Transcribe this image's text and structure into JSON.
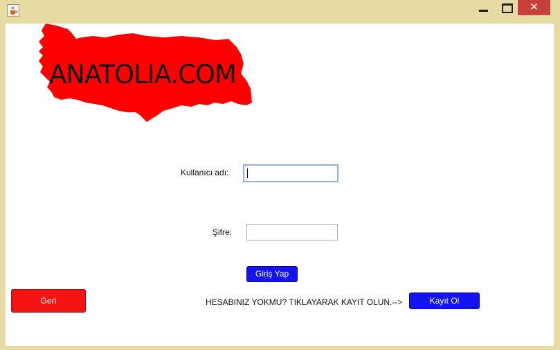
{
  "window": {
    "close_glyph": "✕",
    "icons": {
      "app": "java-cup-icon",
      "minimize": "minimize-icon",
      "maximize": "maximize-icon",
      "close": "close-icon"
    }
  },
  "logo": {
    "text": "ANATOLIA.COM",
    "map_color": "#ff0000"
  },
  "login_form": {
    "username_label": "Kullanıcı adı:",
    "username_value": "",
    "password_label": "Şifre:",
    "password_value": "",
    "login_button": "Giriş Yap"
  },
  "footer": {
    "back_button": "Geri",
    "register_prompt": "HESABINIZ YOKMU? TIKLAYARAK  KAYIT OLUN.-->",
    "register_button": "Kayıt Ol"
  },
  "colors": {
    "blue_button": "#1414ee",
    "red_button": "#f41414",
    "title_bar": "#e6dba2",
    "close_button": "#c8403a"
  }
}
